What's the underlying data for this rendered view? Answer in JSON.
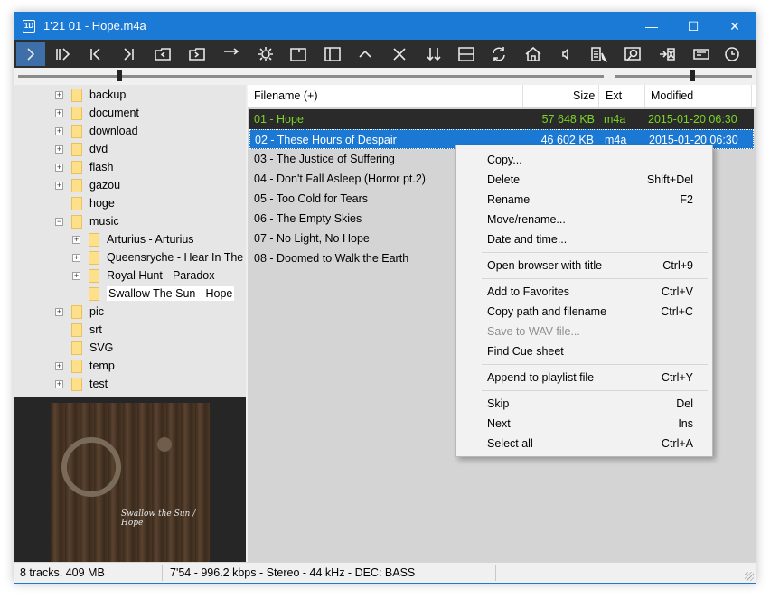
{
  "window": {
    "title": "1'21 01 - Hope.m4a",
    "minimize": "—",
    "maximize": "☐",
    "close": "✕"
  },
  "toolbar": {
    "icons": [
      "play-icon",
      "play-pause-icon",
      "previous-track-icon",
      "next-track-icon",
      "open-folder-back-icon",
      "open-folder-forward-icon",
      "arrow-right-icon",
      "settings-icon",
      "window-layout-icon",
      "sidebar-icon",
      "up-icon",
      "close-icon",
      "sort-icon",
      "split-view-icon",
      "refresh-icon",
      "home-icon",
      "volume-icon",
      "playlist-icon",
      "search-icon",
      "exit-icon",
      "keyboard-icon",
      "clock-icon"
    ]
  },
  "tree": {
    "items": [
      {
        "label": "backup",
        "expand": "+"
      },
      {
        "label": "document",
        "expand": "+"
      },
      {
        "label": "download",
        "expand": "+"
      },
      {
        "label": "dvd",
        "expand": "+"
      },
      {
        "label": "flash",
        "expand": "+"
      },
      {
        "label": "gazou",
        "expand": "+"
      },
      {
        "label": "hoge",
        "expand": ""
      },
      {
        "label": "music",
        "expand": "−"
      },
      {
        "label": "Arturius - Arturius",
        "expand": "+"
      },
      {
        "label": "Queensryche - Hear In The",
        "expand": "+"
      },
      {
        "label": "Royal Hunt - Paradox",
        "expand": "+"
      },
      {
        "label": "Swallow The Sun - Hope",
        "expand": ""
      },
      {
        "label": "pic",
        "expand": "+"
      },
      {
        "label": "srt",
        "expand": ""
      },
      {
        "label": "SVG",
        "expand": ""
      },
      {
        "label": "temp",
        "expand": "+"
      },
      {
        "label": "test",
        "expand": "+"
      }
    ]
  },
  "cover": {
    "text": "Swallow the Sun / Hope"
  },
  "filelist": {
    "columns": {
      "filename": "Filename (+)",
      "size": "Size",
      "ext": "Ext",
      "modified": "Modified"
    },
    "rows": [
      {
        "name": "01 - Hope",
        "size": "57 648 KB",
        "ext": "m4a",
        "modified": "2015-01-20 06:30"
      },
      {
        "name": "02 - These Hours of Despair",
        "size": "46 602 KB",
        "ext": "m4a",
        "modified": "2015-01-20 06:30"
      },
      {
        "name": "03 - The Justice of Suffering",
        "size": "",
        "ext": "",
        "modified": "06:30"
      },
      {
        "name": "04 - Don't Fall Asleep (Horror pt.2)",
        "size": "",
        "ext": "",
        "modified": "06:30"
      },
      {
        "name": "05 - Too Cold for Tears",
        "size": "",
        "ext": "",
        "modified": "06:30"
      },
      {
        "name": "06 - The Empty Skies",
        "size": "",
        "ext": "",
        "modified": "06:30"
      },
      {
        "name": "07 - No Light, No Hope",
        "size": "",
        "ext": "",
        "modified": "06:30"
      },
      {
        "name": "08 - Doomed to Walk the Earth",
        "size": "",
        "ext": "",
        "modified": "06:30"
      }
    ]
  },
  "context_menu": {
    "items": [
      {
        "label": "Copy...",
        "shortcut": ""
      },
      {
        "label": "Delete",
        "shortcut": "Shift+Del"
      },
      {
        "label": "Rename",
        "shortcut": "F2"
      },
      {
        "label": "Move/rename...",
        "shortcut": ""
      },
      {
        "label": "Date and time...",
        "shortcut": ""
      },
      {
        "label": "Open browser with title",
        "shortcut": "Ctrl+9"
      },
      {
        "label": "Add to Favorites",
        "shortcut": "Ctrl+V"
      },
      {
        "label": "Copy path and filename",
        "shortcut": "Ctrl+C"
      },
      {
        "label": "Save to WAV file...",
        "shortcut": ""
      },
      {
        "label": "Find Cue sheet",
        "shortcut": ""
      },
      {
        "label": "Append to playlist file",
        "shortcut": "Ctrl+Y"
      },
      {
        "label": "Skip",
        "shortcut": "Del"
      },
      {
        "label": "Next",
        "shortcut": "Ins"
      },
      {
        "label": "Select all",
        "shortcut": "Ctrl+A"
      }
    ]
  },
  "status": {
    "tracks": "8 tracks, 409 MB",
    "info": "7'54 - 996.2 kbps - Stereo - 44 kHz - DEC: BASS"
  },
  "sliders": {
    "seek_fraction": 0.17,
    "volume_fraction": 0.55
  },
  "colors": {
    "titlebar": "#1a7ad6",
    "toolbar": "#2d2d2d",
    "playing_text": "#7bd427",
    "selection": "#1c79d3"
  }
}
